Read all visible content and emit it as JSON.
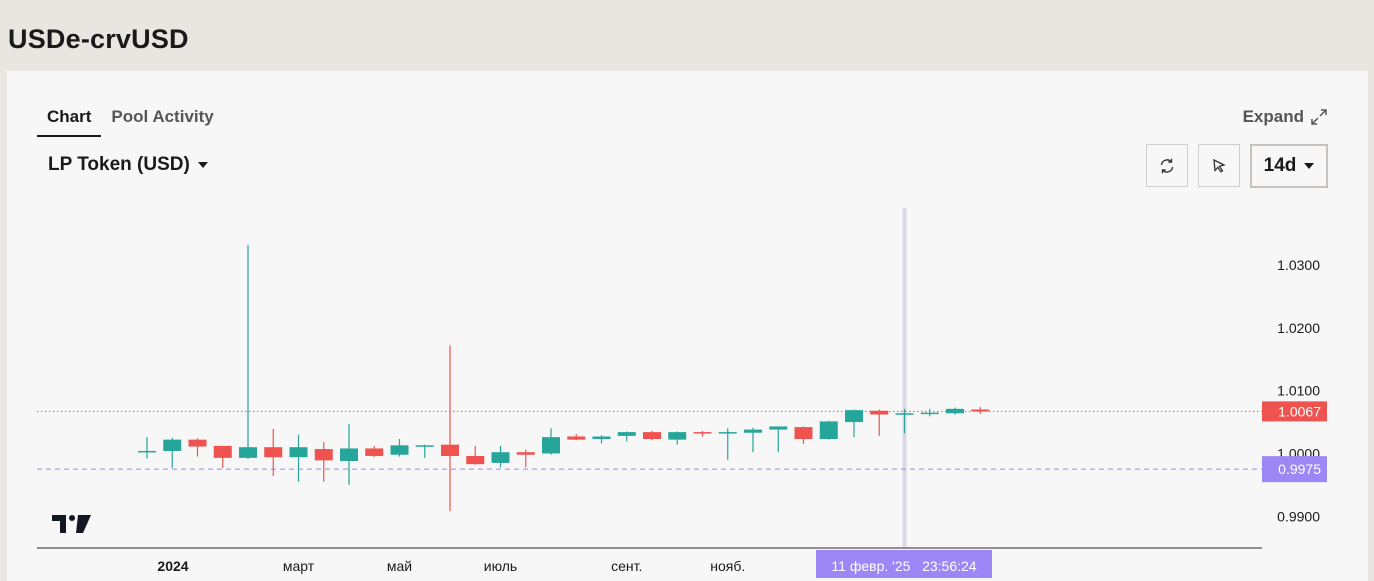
{
  "page": {
    "title": "USDe-crvUSD"
  },
  "tabs": [
    {
      "label": "Chart",
      "active": true
    },
    {
      "label": "Pool Activity",
      "active": false
    }
  ],
  "expand_label": "Expand",
  "token_select": {
    "value": "LP Token (USD)"
  },
  "toolbar": {
    "refresh_icon": "refresh-icon",
    "cursor_icon": "cursor-icon",
    "period_label": "14d"
  },
  "chart_data": {
    "type": "candlestick",
    "x_tick_labels": [
      "2024",
      "март",
      "май",
      "июль",
      "сент.",
      "нояб."
    ],
    "y_tick_labels": [
      "1.0300",
      "1.0200",
      "1.0100",
      "1.0000",
      "0.9900"
    ],
    "ylim": [
      0.9875,
      1.0335
    ],
    "last_price_label": "1.0067",
    "crosshair_price_label": "0.9975",
    "crosshair_time_label": "11 февр. '25   23:56:24",
    "up_color": "#26a69a",
    "down_color": "#ef5350",
    "crosshair_color": "#9b87f5",
    "candles": [
      {
        "o": 1.0002,
        "h": 1.0026,
        "l": 0.9992,
        "c": 1.0004
      },
      {
        "o": 1.0004,
        "h": 1.0025,
        "l": 0.9977,
        "c": 1.0022
      },
      {
        "o": 1.0022,
        "h": 1.0024,
        "l": 0.9995,
        "c": 1.0011
      },
      {
        "o": 1.0012,
        "h": 1.0012,
        "l": 0.9977,
        "c": 0.9993
      },
      {
        "o": 0.9993,
        "h": 1.0332,
        "l": 0.9991,
        "c": 1.001
      },
      {
        "o": 1.001,
        "h": 1.0039,
        "l": 0.9964,
        "c": 0.9994
      },
      {
        "o": 0.9994,
        "h": 1.003,
        "l": 0.9955,
        "c": 1.001
      },
      {
        "o": 1.0007,
        "h": 1.0018,
        "l": 0.9955,
        "c": 0.9989
      },
      {
        "o": 0.9988,
        "h": 1.0047,
        "l": 0.995,
        "c": 1.0008
      },
      {
        "o": 1.0008,
        "h": 1.0012,
        "l": 0.9994,
        "c": 0.9996
      },
      {
        "o": 0.9998,
        "h": 1.0023,
        "l": 0.9995,
        "c": 1.0013
      },
      {
        "o": 1.0013,
        "h": 1.0014,
        "l": 0.9993,
        "c": 1.0013
      },
      {
        "o": 1.0014,
        "h": 1.0172,
        "l": 0.9908,
        "c": 0.9996
      },
      {
        "o": 0.9996,
        "h": 1.0012,
        "l": 0.9982,
        "c": 0.9983
      },
      {
        "o": 0.9985,
        "h": 1.0012,
        "l": 0.9978,
        "c": 1.0002
      },
      {
        "o": 1.0002,
        "h": 1.0006,
        "l": 0.9978,
        "c": 0.9998
      },
      {
        "o": 1.0,
        "h": 1.004,
        "l": 0.9998,
        "c": 1.0026
      },
      {
        "o": 1.0027,
        "h": 1.0031,
        "l": 1.0021,
        "c": 1.0022
      },
      {
        "o": 1.0023,
        "h": 1.0029,
        "l": 1.0016,
        "c": 1.0027
      },
      {
        "o": 1.0028,
        "h": 1.0035,
        "l": 1.0019,
        "c": 1.0034
      },
      {
        "o": 1.0034,
        "h": 1.0036,
        "l": 1.0021,
        "c": 1.0023
      },
      {
        "o": 1.0022,
        "h": 1.0035,
        "l": 1.0014,
        "c": 1.0034
      },
      {
        "o": 1.0034,
        "h": 1.0036,
        "l": 1.0027,
        "c": 1.0032
      },
      {
        "o": 1.0033,
        "h": 1.004,
        "l": 0.999,
        "c": 1.0034
      },
      {
        "o": 1.0033,
        "h": 1.0041,
        "l": 1.0002,
        "c": 1.0038
      },
      {
        "o": 1.0038,
        "h": 1.0043,
        "l": 1.0002,
        "c": 1.0043
      },
      {
        "o": 1.0042,
        "h": 1.0043,
        "l": 1.0015,
        "c": 1.0023
      },
      {
        "o": 1.0023,
        "h": 1.0052,
        "l": 1.0022,
        "c": 1.0051
      },
      {
        "o": 1.005,
        "h": 1.007,
        "l": 1.0026,
        "c": 1.0069
      },
      {
        "o": 1.0068,
        "h": 1.007,
        "l": 1.0028,
        "c": 1.0062
      },
      {
        "o": 1.0062,
        "h": 1.0071,
        "l": 1.0032,
        "c": 1.0064
      },
      {
        "o": 1.0063,
        "h": 1.0071,
        "l": 1.0059,
        "c": 1.0065
      },
      {
        "o": 1.0064,
        "h": 1.0073,
        "l": 1.0062,
        "c": 1.0071
      },
      {
        "o": 1.007,
        "h": 1.0074,
        "l": 1.0063,
        "c": 1.0067
      }
    ]
  }
}
